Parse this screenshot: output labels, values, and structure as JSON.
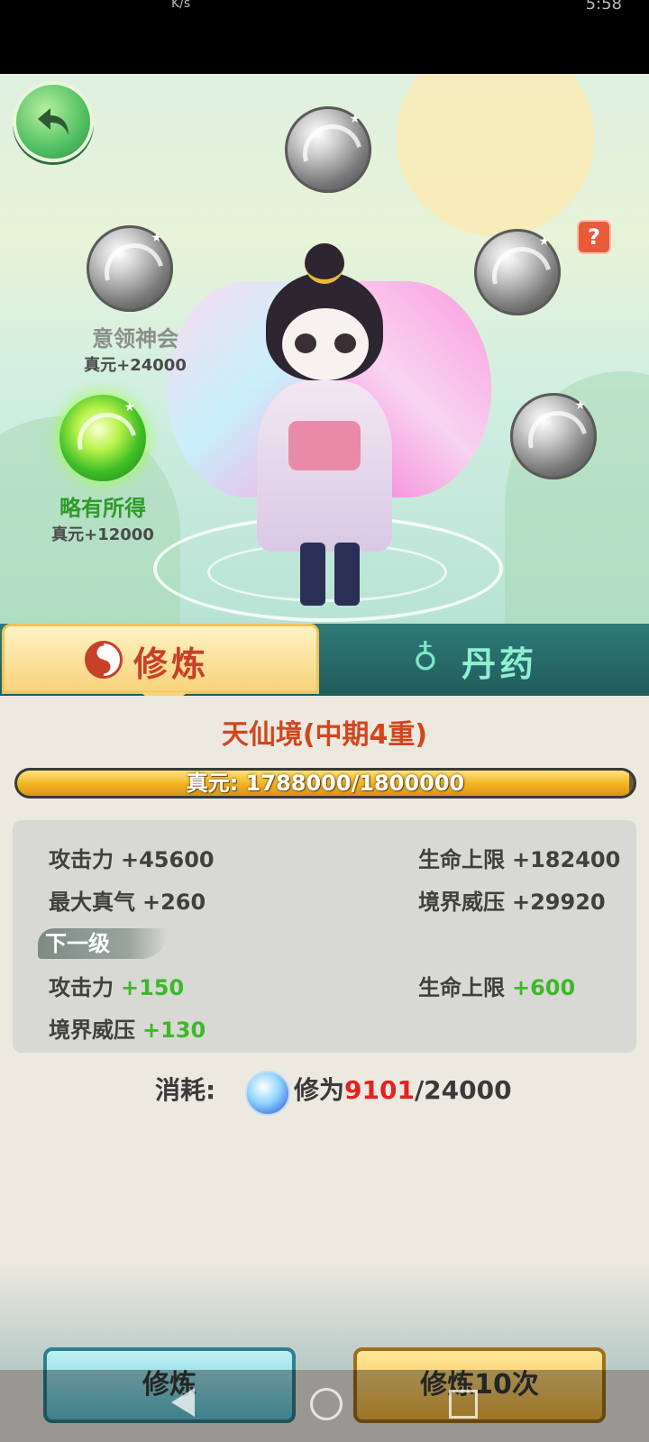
{
  "status_bar": {
    "speed_unit": "K/s",
    "time": "5:58"
  },
  "scene": {
    "nodes": [
      {
        "name": "意领神会",
        "gain": "真元+24000",
        "state": "locked"
      },
      {
        "name": "略有所得",
        "gain": "真元+12000",
        "state": "unlocked"
      }
    ],
    "help_label": "?"
  },
  "tabs": [
    {
      "label": "修炼",
      "active": true
    },
    {
      "label": "丹药",
      "active": false
    }
  ],
  "realm": {
    "title": "天仙境(中期4重)"
  },
  "progress": {
    "label": "真元: 1788000/1800000",
    "current": 1788000,
    "max": 1800000
  },
  "stats": {
    "current": [
      {
        "label": "攻击力",
        "value": "+45600"
      },
      {
        "label": "生命上限",
        "value": "+182400"
      },
      {
        "label": "最大真气",
        "value": "+260"
      },
      {
        "label": "境界威压",
        "value": "+29920"
      }
    ],
    "next_level_label": "下一级",
    "next": [
      {
        "label": "攻击力",
        "value": "+150"
      },
      {
        "label": "生命上限",
        "value": "+600"
      },
      {
        "label": "境界威压",
        "value": "+130"
      }
    ]
  },
  "cost": {
    "label": "消耗:",
    "resource": "修为",
    "have": "9101",
    "need": "/24000"
  },
  "buttons": {
    "train": "修炼",
    "train10": "修炼10次"
  },
  "colors": {
    "accent_orange": "#d2461e",
    "gain_green": "#3db82a",
    "cost_red": "#e52020",
    "tab_teal": "#1f5c5c"
  }
}
